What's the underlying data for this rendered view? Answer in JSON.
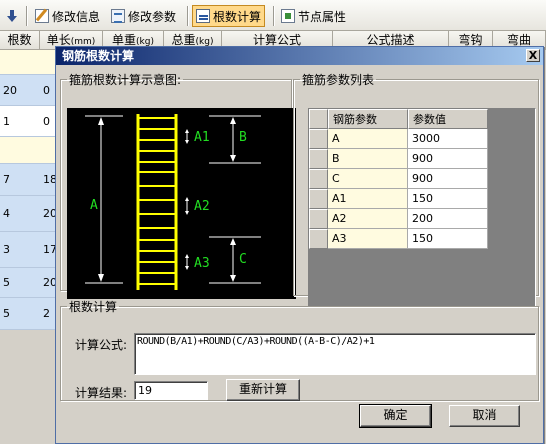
{
  "toolbar": {
    "items": [
      {
        "label": ""
      },
      {
        "label": "修改信息"
      },
      {
        "label": "修改参数"
      },
      {
        "label": "根数计算"
      },
      {
        "label": "节点属性"
      }
    ]
  },
  "grid": {
    "headers": [
      {
        "label": "根数"
      },
      {
        "label": "单长",
        "unit": "(mm)"
      },
      {
        "label": "单重",
        "unit": "(kg)"
      },
      {
        "label": "总重",
        "unit": "(kg)"
      },
      {
        "label": "计算公式"
      },
      {
        "label": "公式描述"
      },
      {
        "label": "弯钩"
      },
      {
        "label": "弯曲"
      }
    ],
    "rows": [
      {
        "count": "",
        "len": "",
        "bg": "#fffbe0"
      },
      {
        "count": "20",
        "len": "0",
        "bg": "#cfe0f4"
      },
      {
        "count": "1",
        "len": "0",
        "bg": "#ffffff"
      },
      {
        "count": "",
        "len": "",
        "bg": "#fffbe0"
      },
      {
        "count": "7",
        "len": "18",
        "bg": "#cfe0f4"
      },
      {
        "count": "4",
        "len": "20",
        "bg": "#cfe0f4"
      },
      {
        "count": "3",
        "len": "17",
        "bg": "#cfe0f4"
      },
      {
        "count": "5",
        "len": "20",
        "bg": "#cfe0f4"
      },
      {
        "count": "5",
        "len": "2",
        "bg": "#cfe0f4"
      }
    ]
  },
  "dialog": {
    "title": "钢筋根数计算",
    "close": "X",
    "diagram_group": "箍筋根数计算示意图:",
    "diagram_labels": {
      "A": "A",
      "A1": "A1",
      "B": "B",
      "A2": "A2",
      "A3": "A3",
      "C": "C"
    },
    "param_group": "箍筋参数列表",
    "param_table": {
      "headers": [
        "钢筋参数",
        "参数值"
      ],
      "rows": [
        {
          "name": "A",
          "value": "3000"
        },
        {
          "name": "B",
          "value": "900"
        },
        {
          "name": "C",
          "value": "900"
        },
        {
          "name": "A1",
          "value": "150"
        },
        {
          "name": "A2",
          "value": "200"
        },
        {
          "name": "A3",
          "value": "150"
        }
      ]
    },
    "calc_group": "根数计算",
    "formula_label": "计算公式:",
    "formula": "ROUND(B/A1)+ROUND(C/A3)+ROUND((A-B-C)/A2)+1",
    "result_label": "计算结果:",
    "result": "19",
    "recalc_button": "重新计算",
    "ok_button": "确定",
    "cancel_button": "取消"
  },
  "colors": {
    "diagram_bg": "#000000",
    "ladder": "#ffff00",
    "diagram_text": "#22dd22",
    "titlebar": "#0a246a"
  }
}
